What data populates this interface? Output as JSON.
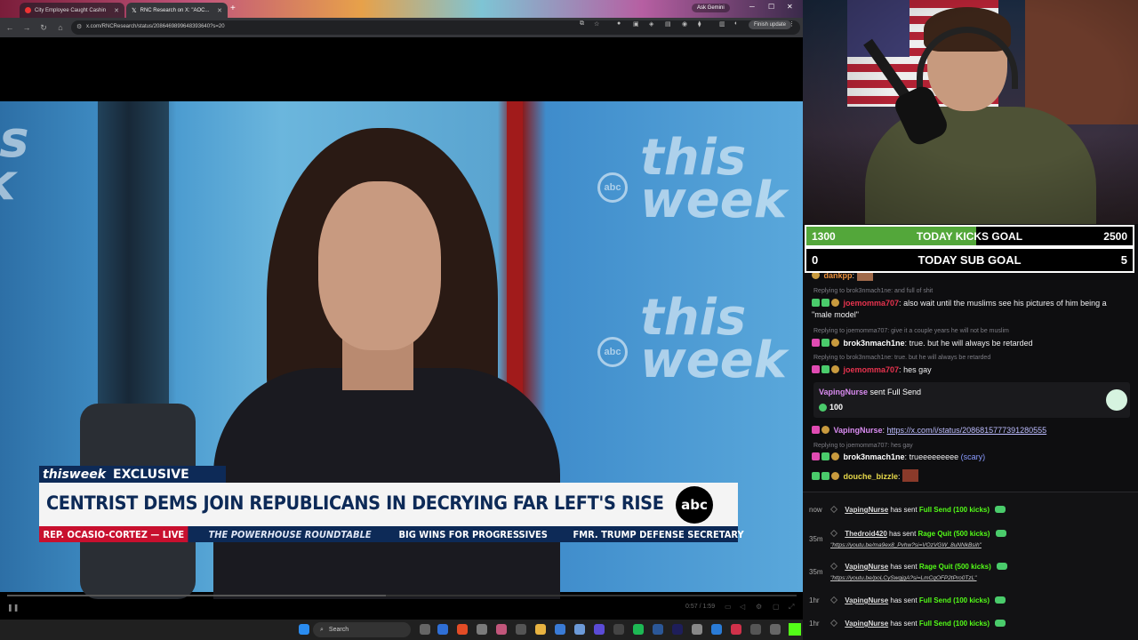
{
  "browser": {
    "tabs": [
      {
        "title": "City Employee Caught Cashin"
      },
      {
        "title": "RNC Research on X: \"AOC..."
      }
    ],
    "url": "x.com/RNCResearch/status/2086469899648393640?s=20",
    "ask_gemini": "Ask Gemini",
    "finish_update": "Finish update"
  },
  "video": {
    "watermark": "this week",
    "watermark_logo": "abc",
    "show_badge": "thisweek",
    "badge_label": "EXCLUSIVE",
    "headline": "CENTRIST DEMS JOIN REPUBLICANS IN DECRYING FAR LEFT'S RISE",
    "network_logo": "abc",
    "ticker": [
      "REP. OCASIO-CORTEZ — LIVE",
      "THE POWERHOUSE ROUNDTABLE",
      "BIG WINS FOR PROGRESSIVES",
      "FMR. TRUMP DEFENSE SECRETARY"
    ],
    "time": "0:57 / 1:59",
    "progress": 0.48
  },
  "taskbar": {
    "search_label": "Search"
  },
  "goals": {
    "kicks": {
      "current": "1300",
      "label": "TODAY KICKS GOAL",
      "target": "2500",
      "fill": 0.52
    },
    "subs": {
      "current": "0",
      "label": "TODAY SUB GOAL",
      "target": "5"
    }
  },
  "chat": {
    "messages": [
      {
        "user": "dankpp",
        "text": "",
        "color": "#e88f3c"
      },
      {
        "reply": "Replying to brok3nmach1ne: and full of shit"
      },
      {
        "user": "joemomma707",
        "text": "also wait until the muslims see his pictures of him being a",
        "text2": "\"male model\"",
        "color": "#e8334e"
      },
      {
        "reply": "Replying to joemomma707: give it a couple years he will not be muslim"
      },
      {
        "user": "brok3nmach1ne",
        "text": "true. but he will always be retarded",
        "color": "#ffffff"
      },
      {
        "reply": "Replying to brok3nmach1ne: true. but he will always be retarded"
      },
      {
        "user": "joemomma707",
        "text": "hes gay",
        "color": "#e8334e"
      },
      {
        "user": "VapingNurse",
        "text": "https://x.com/i/status/2086815777391280555",
        "color": "#d98bf0"
      },
      {
        "reply": "Replying to joemomma707: hes gay"
      },
      {
        "user": "brok3nmach1ne",
        "text": "trueeeeeeeee",
        "scary": "(scary)",
        "color": "#ffffff"
      },
      {
        "user": "douche_bizzle",
        "text": "",
        "color": "#e6d84a"
      }
    ],
    "fullsend": {
      "user": "VapingNurse",
      "action": "sent Full Send",
      "amount": "100"
    }
  },
  "events": [
    {
      "age": "now",
      "user": "VapingNurse",
      "verb": "has sent",
      "gift": "Full Send (100 kicks)",
      "url": ""
    },
    {
      "age": "35m",
      "user": "Thedroid420",
      "verb": "has sent",
      "gift": "Rage Quit (500 kicks)",
      "url": "\"https://youtu.be/ma9ex8_Pvhw?si=VOzVGW_8uNNkBsih\""
    },
    {
      "age": "35m",
      "user": "VapingNurse",
      "verb": "has sent",
      "gift": "Rage Quit (500 kicks)",
      "url": "\"https://youtu.be/poLCySwqjgA?si=LmCqOFP2tPro0TzL\""
    },
    {
      "age": "1hr",
      "user": "VapingNurse",
      "verb": "has sent",
      "gift": "Full Send (100 kicks)",
      "url": ""
    },
    {
      "age": "1hr",
      "user": "VapingNurse",
      "verb": "has sent",
      "gift": "Full Send (100 kicks)",
      "url": ""
    }
  ],
  "colors": {
    "kick_green": "#53fc18",
    "goal_fill": "#53a73a",
    "abc_navy": "#0d2a57",
    "ticker_red": "#c8102e"
  }
}
